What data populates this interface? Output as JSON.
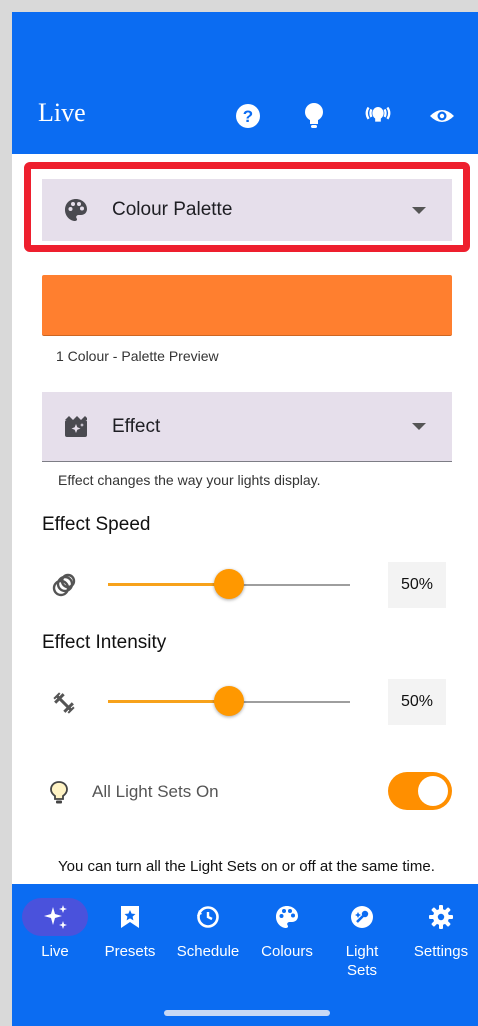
{
  "appbar": {
    "title": "Live",
    "icons": [
      "help-icon",
      "bulb-icon",
      "broadcast-bulb-icon",
      "eye-icon"
    ]
  },
  "palette_dropdown": {
    "label": "Colour Palette",
    "icon": "palette-icon"
  },
  "palette_preview": {
    "color": "#ff7f2f",
    "caption": "1 Colour - Palette Preview"
  },
  "effect_dropdown": {
    "label": "Effect",
    "icon": "effect-icon",
    "helper": "Effect changes the way your lights display."
  },
  "effect_speed": {
    "title": "Effect Speed",
    "value": 0.5,
    "value_text": "50%"
  },
  "effect_intensity": {
    "title": "Effect Intensity",
    "value": 0.5,
    "value_text": "50%"
  },
  "all_light_sets": {
    "label": "All Light Sets On",
    "on": true
  },
  "description": "You can turn all the Light Sets on or off at the same time. This is separate from turning the main",
  "colors": {
    "primary": "#0b6cf2",
    "accent": "#ff9800",
    "highlight": "#ee1f2e"
  },
  "bottom_nav": {
    "items": [
      {
        "label": "Live",
        "icon": "sparkle-icon",
        "active": true
      },
      {
        "label": "Presets",
        "icon": "bookmark-star-icon",
        "active": false
      },
      {
        "label": "Schedule",
        "icon": "schedule-icon",
        "active": false
      },
      {
        "label": "Colours",
        "icon": "palette-icon",
        "active": false
      },
      {
        "label": "Light\nSets",
        "icon": "light-sets-icon",
        "active": false
      },
      {
        "label": "Settings",
        "icon": "gear-icon",
        "active": false
      }
    ]
  }
}
